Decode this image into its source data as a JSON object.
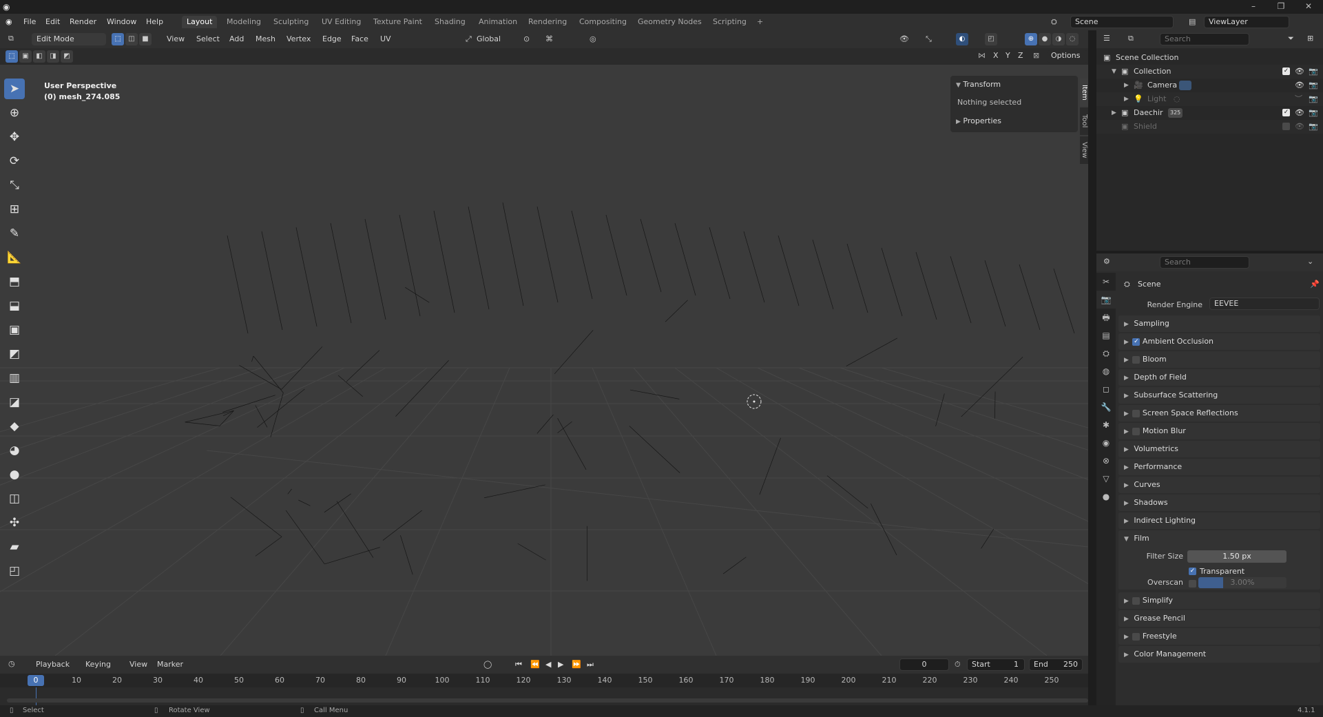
{
  "window": {
    "controls": [
      "–",
      "❐",
      "✕"
    ]
  },
  "menu": {
    "items": [
      "File",
      "Edit",
      "Render",
      "Window",
      "Help"
    ],
    "workspaces": [
      "Layout",
      "Modeling",
      "Sculpting",
      "UV Editing",
      "Texture Paint",
      "Shading",
      "Animation",
      "Rendering",
      "Compositing",
      "Geometry Nodes",
      "Scripting"
    ],
    "add_tab": "+",
    "scene": "Scene",
    "view_layer": "ViewLayer"
  },
  "viewport_header": {
    "mode": "Edit Mode",
    "menus": [
      "View",
      "Select",
      "Add",
      "Mesh",
      "Vertex",
      "Edge",
      "Face",
      "UV"
    ],
    "orientation": "Global",
    "axes": [
      "X",
      "Y",
      "Z"
    ],
    "options": "Options"
  },
  "viewport": {
    "perspective": "User Perspective",
    "object": "(0) mesh_274.085",
    "grid_color": "#4a4a4a",
    "wire_color": "#111111"
  },
  "npanel": {
    "transform": "Transform",
    "nothing_selected": "Nothing selected",
    "properties": "Properties",
    "tabs": [
      "Item",
      "Tool",
      "View"
    ]
  },
  "outliner": {
    "search_placeholder": "Search",
    "rows": [
      {
        "label": "Scene Collection",
        "badge": ""
      },
      {
        "label": "Collection",
        "badge": ""
      },
      {
        "label": "Camera",
        "badge": ""
      },
      {
        "label": "Light",
        "badge": ""
      },
      {
        "label": "Daechir",
        "badge": "325"
      },
      {
        "label": "Shield",
        "badge": ""
      }
    ]
  },
  "properties": {
    "search_placeholder": "Search",
    "scene_label": "Scene",
    "render_engine_label": "Render Engine",
    "render_engine": "EEVEE",
    "panels": [
      "Sampling",
      "Ambient Occlusion",
      "Bloom",
      "Depth of Field",
      "Subsurface Scattering",
      "Screen Space Reflections",
      "Motion Blur",
      "Volumetrics",
      "Performance",
      "Curves",
      "Shadows",
      "Indirect Lighting",
      "Film"
    ],
    "film": {
      "filter_size_label": "Filter Size",
      "filter_size": "1.50 px",
      "transparent_label": "Transparent",
      "overscan_label": "Overscan",
      "overscan": "3.00%"
    },
    "panels_after": [
      "Simplify",
      "Grease Pencil",
      "Freestyle",
      "Color Management"
    ]
  },
  "timeline": {
    "menus": [
      "Playback",
      "Keying",
      "View",
      "Marker"
    ],
    "current_frame": "0",
    "start_label": "Start",
    "start": "1",
    "end_label": "End",
    "end": "250",
    "ticks": [
      "0",
      "10",
      "20",
      "30",
      "40",
      "50",
      "60",
      "70",
      "80",
      "90",
      "100",
      "110",
      "120",
      "130",
      "140",
      "150",
      "160",
      "170",
      "180",
      "190",
      "200",
      "210",
      "220",
      "230",
      "240",
      "250"
    ]
  },
  "status": {
    "select": "Select",
    "rotate": "Rotate View",
    "call_menu": "Call Menu",
    "version": "4.1.1"
  },
  "colors": {
    "accent": "#4772b3"
  }
}
